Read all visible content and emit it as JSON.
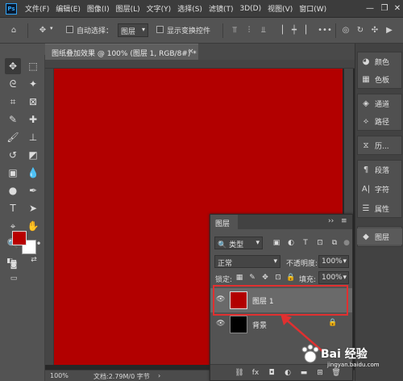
{
  "app": {
    "logo": "Ps"
  },
  "menu": [
    "文件(F)",
    "编辑(E)",
    "图像(I)",
    "图层(L)",
    "文字(Y)",
    "选择(S)",
    "滤镜(T)",
    "3D(D)",
    "视图(V)",
    "窗口(W)"
  ],
  "options_bar": {
    "auto_select_label": "自动选择：",
    "layer_select_value": "图层",
    "show_transform_label": "显示变换控件"
  },
  "document": {
    "tab_title": "图纸叠加效果 @ 100% (图层 1, RGB/8#) *",
    "fill_color": "#b20000",
    "zoom": "100%",
    "doc_info": "文档:2.79M/0 字节"
  },
  "colors": {
    "foreground": "#b80000",
    "background": "#ffffff",
    "highlight": "#e03030"
  },
  "dock": {
    "items": [
      {
        "icon": "palette-icon",
        "label": "颜色"
      },
      {
        "icon": "swatches-icon",
        "label": "色板"
      },
      {
        "icon": "channels-icon",
        "label": "通道"
      },
      {
        "icon": "paths-icon",
        "label": "路径"
      },
      {
        "icon": "history-icon",
        "label": "历..."
      },
      {
        "icon": "paragraph-icon",
        "label": "段落"
      },
      {
        "icon": "character-icon",
        "label": "字符"
      },
      {
        "icon": "properties-icon",
        "label": "属性"
      },
      {
        "icon": "layers-icon",
        "label": "图层"
      }
    ]
  },
  "layers_panel": {
    "title": "图层",
    "filter_kind": "类型",
    "blend_mode": "正常",
    "opacity_label": "不透明度:",
    "opacity_value": "100%",
    "lock_label": "锁定:",
    "fill_label": "填充:",
    "fill_value": "100%",
    "layers": [
      {
        "name": "图层 1",
        "color": "#b20000",
        "selected": true
      },
      {
        "name": "背景",
        "color": "#000000",
        "locked": true
      }
    ]
  },
  "watermark": {
    "text": "Bai 经验",
    "sub": "jingyan.baidu.com"
  }
}
